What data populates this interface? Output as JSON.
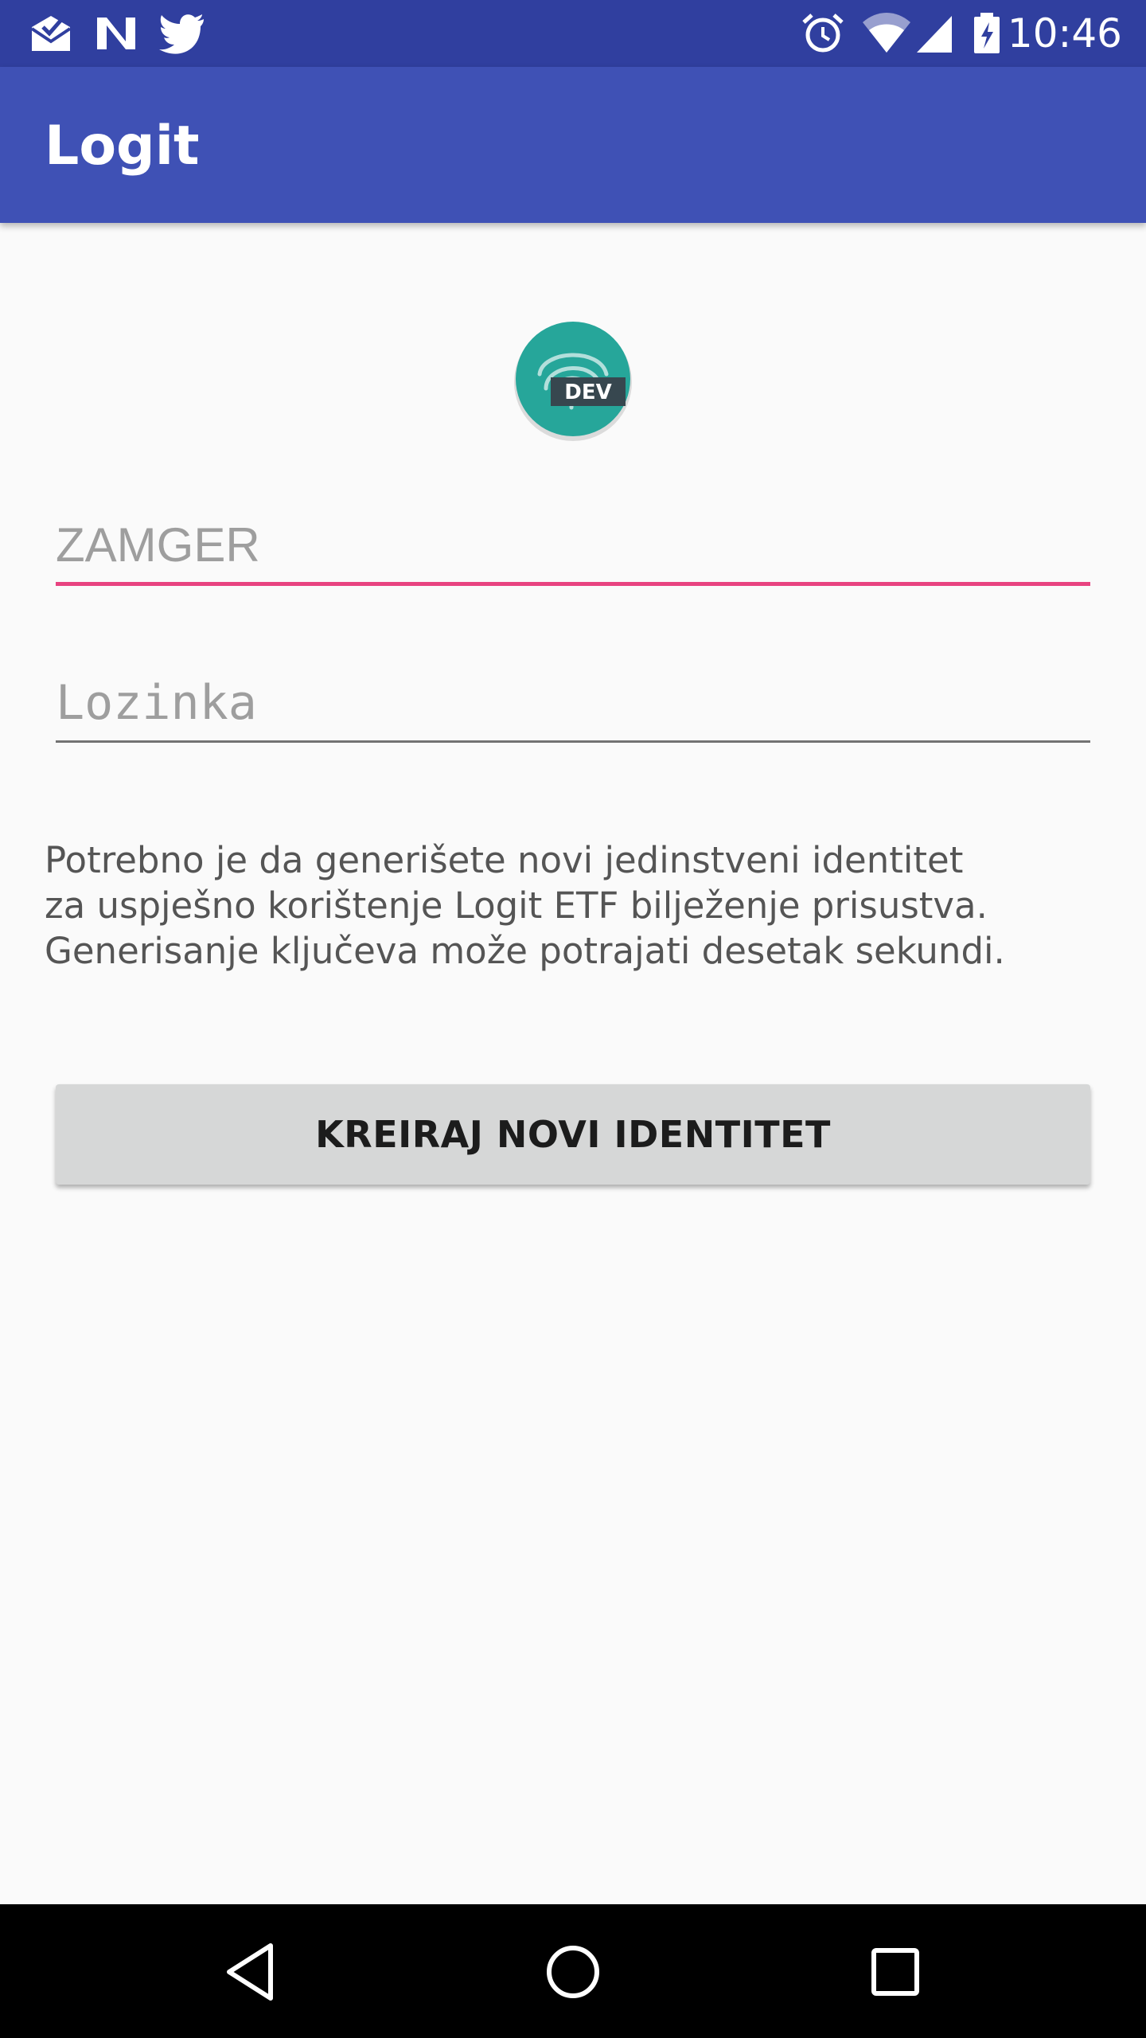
{
  "status_bar": {
    "time": "10:46",
    "left_icons": [
      "mail-icon",
      "n-app-icon",
      "twitter-icon"
    ],
    "right_icons": [
      "alarm-icon",
      "wifi-icon",
      "signal-icon",
      "battery-charging-icon"
    ],
    "color": "#303f9f"
  },
  "app_bar": {
    "title": "Logit",
    "color": "#3f51b5"
  },
  "logo": {
    "badge": "DEV",
    "icon": "fingerprint-icon",
    "color": "#26a69a"
  },
  "form": {
    "zamger": {
      "value": "",
      "placeholder": "ZAMGER",
      "accent": "#e84380"
    },
    "password": {
      "value": "",
      "placeholder": "Lozinka"
    }
  },
  "info": {
    "line1": "Potrebno je da generišete novi jedinstveni identitet",
    "line2": "za uspješno korištenje Logit ETF bilježenje prisustva.",
    "line3": "Generisanje ključeva može potrajati desetak sekundi."
  },
  "actions": {
    "create_label": "KREIRAJ NOVI IDENTITET"
  },
  "nav_bar": {
    "buttons": [
      "back-icon",
      "home-icon",
      "recents-icon"
    ]
  }
}
